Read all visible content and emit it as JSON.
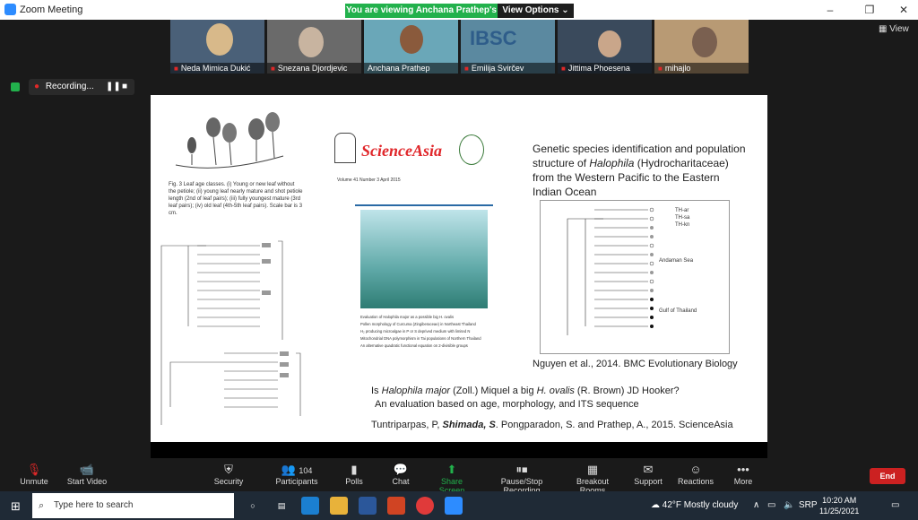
{
  "window": {
    "title": "Zoom Meeting",
    "banner": "You are viewing Anchana Prathep's screen",
    "view_options": "View Options ⌄"
  },
  "participants": [
    {
      "name": "Neda Mimica Dukić",
      "bg": "#4a6078"
    },
    {
      "name": "Snezana Djordjevic",
      "bg": "#6a6a6a"
    },
    {
      "name": "Anchana Prathep",
      "bg": "#6aa7b8"
    },
    {
      "name": "Emilija Svirčev",
      "bg": "#5b89a0"
    },
    {
      "name": "Jittima Phoesena",
      "bg": "#3a4a5c"
    },
    {
      "name": "mihajlo",
      "bg": "#b89a74"
    }
  ],
  "view_button": "View",
  "recording": {
    "label": "Recording..."
  },
  "slide": {
    "fig_caption": "Fig. 3 Leaf age classes. (i) Young or new leaf without the petiole; (ii) young leaf nearly mature and shot petiole length (2nd of leaf pairs); (iii) fully youngest mature (3rd leaf pairs); (iv) old leaf (4th-5th leaf pairs). Scale bar is 3 cm.",
    "science_asia": "ScienceAsia",
    "sa_volume": "Volume 41 Number 3 April 2015",
    "sa_items": [
      "Evaluation of Halophila major as a possible big H. ovalis",
      "Pollen morphology of Curcuma (Zingiberaceae) in Northeast Thailand",
      "H₂ producing microalgae in P or S deprived medium with limited N",
      "Mitochondrial DNA polymorphism in Tai populations of Northern Thailand",
      "An alternative quadratic functional equation on 2-divisible groups"
    ],
    "title_right_1": "Genetic species identification and population structure of ",
    "title_right_italic": "Halophila",
    "title_right_2": " (Hydrocharitaceae) from the Western Pacific to the Eastern Indian Ocean",
    "tree_labels": [
      "TH-ar",
      "TH-sa",
      "TH-kn",
      "Andaman Sea",
      "Gulf of Thailand"
    ],
    "cite_right": "Nguyen et al., 2014. BMC Evolutionary Biology",
    "bottom_title_1": "Is ",
    "bottom_title_italic1": "Halophila major",
    "bottom_title_2": " (Zoll.) Miquel a big ",
    "bottom_title_italic2": "H. ovalis",
    "bottom_title_3": " (R. Brown) JD Hooker?",
    "bottom_title_4": "An evaluation based on age, morphology, and ITS sequence",
    "authors_1": "Tuntriparpas, P, ",
    "authors_bold": "Shimada, S",
    "authors_2": ". Pongparadon, S. and Prathep, A., 2015. ScienceAsia"
  },
  "toolbar": {
    "items": [
      {
        "label": "Unmute",
        "icon": "mic-off-icon",
        "glyph": "🎙"
      },
      {
        "label": "Start Video",
        "icon": "video-off-icon",
        "glyph": "📹"
      },
      {
        "label": "Security",
        "icon": "shield-icon",
        "glyph": "🛡"
      },
      {
        "label": "Participants",
        "icon": "participants-icon",
        "glyph": "👥"
      },
      {
        "label": "Polls",
        "icon": "polls-icon",
        "glyph": "▮"
      },
      {
        "label": "Chat",
        "icon": "chat-icon",
        "glyph": "💬"
      },
      {
        "label": "Share Screen",
        "icon": "share-screen-icon",
        "glyph": "⬆"
      },
      {
        "label": "Pause/Stop Recording",
        "icon": "pause-recording-icon",
        "glyph": "⏸"
      },
      {
        "label": "Breakout Rooms",
        "icon": "breakout-icon",
        "glyph": "▦"
      },
      {
        "label": "Support",
        "icon": "support-icon",
        "glyph": "✉"
      },
      {
        "label": "Reactions",
        "icon": "reactions-icon",
        "glyph": "☺"
      },
      {
        "label": "More",
        "icon": "more-icon",
        "glyph": "•••"
      }
    ],
    "participant_count": "104",
    "end": "End"
  },
  "taskbar": {
    "search_placeholder": "Type here to search",
    "weather": "42°F  Mostly cloudy",
    "lang": "SRP",
    "time": "10:20 AM",
    "date": "11/25/2021"
  },
  "colors": {
    "share_green": "#22b14c",
    "end_red": "#cc2121",
    "recording_red": "#e02828"
  }
}
